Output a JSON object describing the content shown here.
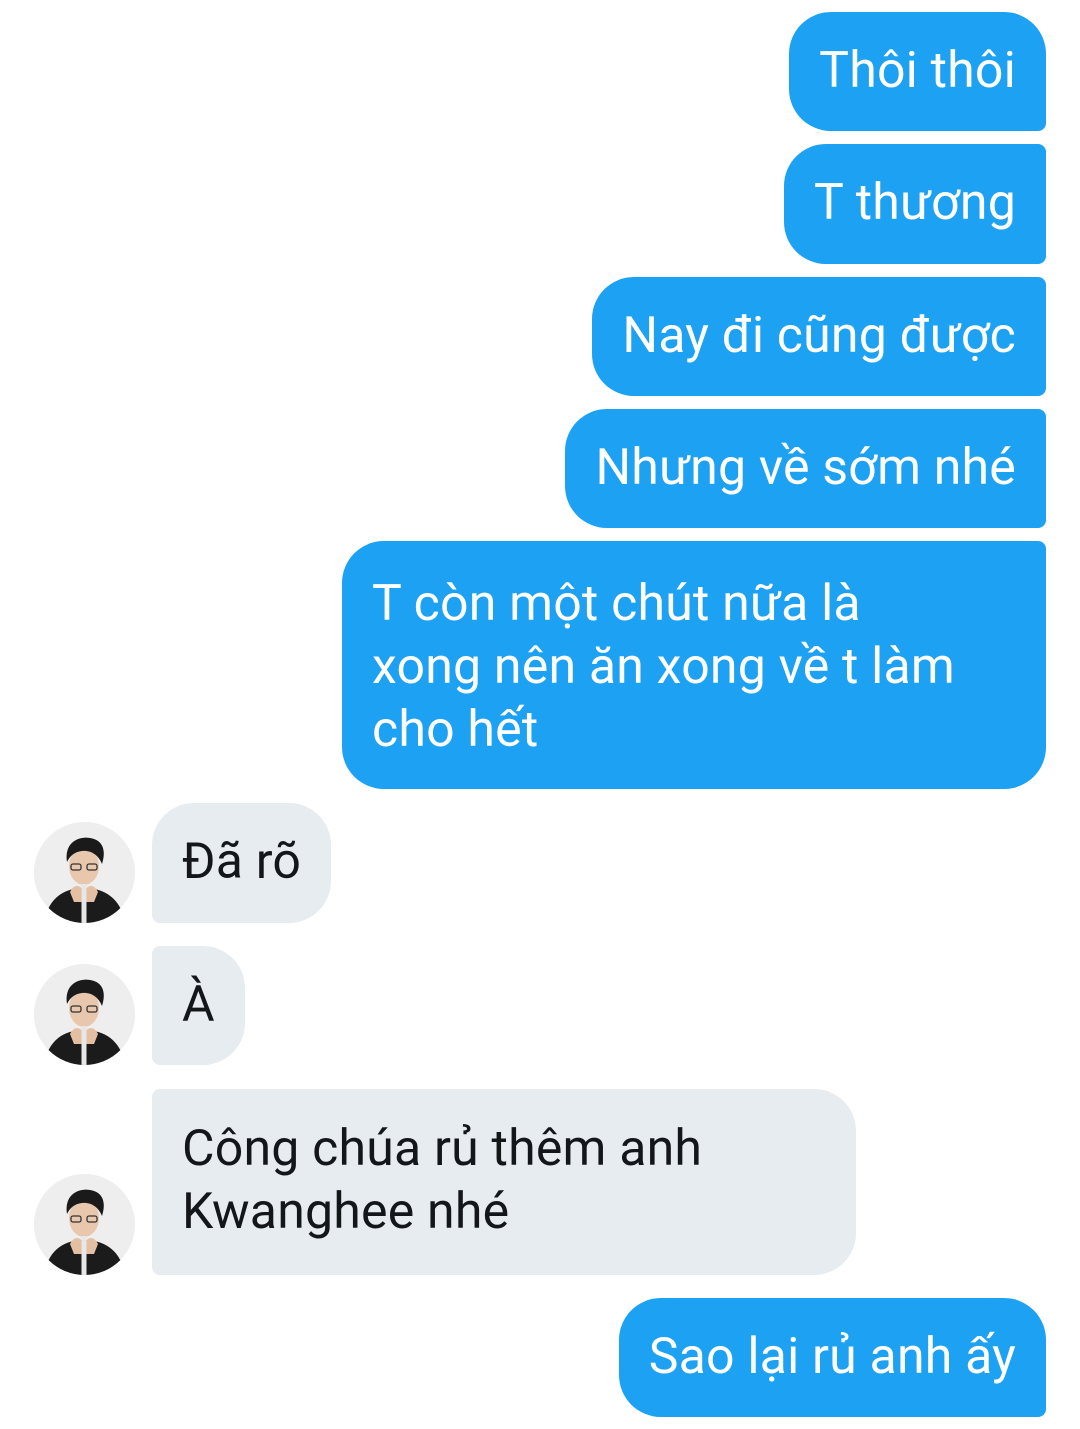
{
  "messages": {
    "m1": "Thôi thôi",
    "m2": "T thương",
    "m3": "Nay đi cũng được",
    "m4": "Nhưng về sớm nhé",
    "m5_lines": [
      "T còn một chút nữa là",
      "xong nên ăn xong về t làm",
      "cho hết"
    ],
    "m6": "Đã rõ",
    "m7": "À",
    "m8_lines": [
      "Công chúa rủ thêm anh",
      "Kwanghee nhé"
    ],
    "m9": "Sao lại rủ anh ấy"
  },
  "colors": {
    "outgoing_bubble": "#1da1f2",
    "incoming_bubble": "#e6ecf0",
    "outgoing_text": "#ffffff",
    "incoming_text": "#14171a"
  },
  "icons": {
    "avatar": "user-avatar-photo"
  }
}
